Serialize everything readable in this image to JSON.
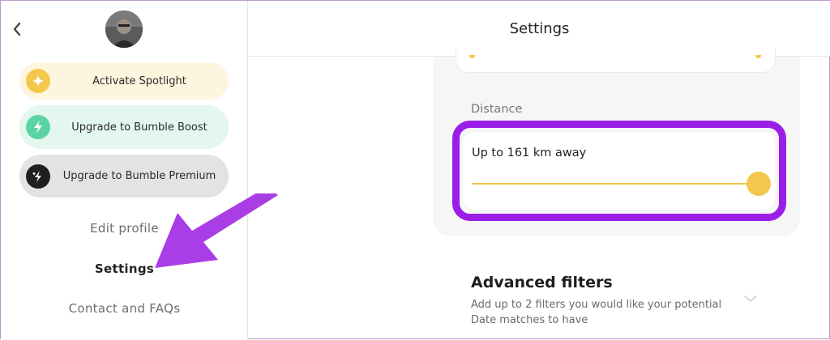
{
  "header": {
    "title": "Settings",
    "back_icon": "chevron-left-icon"
  },
  "sidebar": {
    "avatar": "profile-photo",
    "promos": [
      {
        "label": "Activate Spotlight",
        "icon": "sparkle-icon",
        "color": "#f5c84c",
        "bg": "#fdf5dd"
      },
      {
        "label": "Upgrade to Bumble Boost",
        "icon": "lightning-icon",
        "color": "#5ad4a4",
        "bg": "#e4f7ef"
      },
      {
        "label": "Upgrade to Bumble Premium",
        "icon": "lightning-sparkle-icon",
        "color": "#1f1f1f",
        "bg": "#e3e3e3"
      }
    ],
    "nav": {
      "edit_profile": "Edit profile",
      "settings": "Settings",
      "contact": "Contact and FAQs"
    }
  },
  "filters": {
    "distance": {
      "section_label": "Distance",
      "value_text": "Up to 161 km away",
      "slider_fraction": 1.0
    },
    "advanced": {
      "title": "Advanced filters",
      "description": "Add up to 2 filters you would like your potential Date matches to have"
    }
  },
  "colors": {
    "accent_yellow": "#f3c74d",
    "highlight_purple": "#9a1ee8",
    "annotation_arrow": "#a93ee6"
  }
}
